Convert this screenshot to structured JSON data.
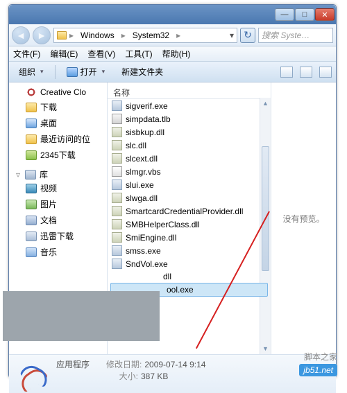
{
  "breadcrumb": {
    "p1": "Windows",
    "p2": "System32"
  },
  "search": {
    "placeholder": "搜索 Syste…"
  },
  "menus": {
    "file": "文件(F)",
    "edit": "编辑(E)",
    "view": "查看(V)",
    "tools": "工具(T)",
    "help": "帮助(H)"
  },
  "toolbar": {
    "org": "组织",
    "open": "打开",
    "newfolder": "新建文件夹"
  },
  "side": {
    "cc": "Creative Clo",
    "downloads": "下载",
    "desktop": "桌面",
    "recent": "最近访问的位",
    "dl2345": "2345下载",
    "lib": "库",
    "video": "视频",
    "pic": "图片",
    "doc": "文档",
    "xunlei": "迅雷下载",
    "music": "音乐"
  },
  "col": {
    "name": "名称"
  },
  "files": [
    {
      "n": "sigverif.exe",
      "t": "exe"
    },
    {
      "n": "simpdata.tlb",
      "t": "tlb"
    },
    {
      "n": "sisbkup.dll",
      "t": "dll"
    },
    {
      "n": "slc.dll",
      "t": "dll"
    },
    {
      "n": "slcext.dll",
      "t": "dll"
    },
    {
      "n": "slmgr.vbs",
      "t": "vbs"
    },
    {
      "n": "slui.exe",
      "t": "exe"
    },
    {
      "n": "slwga.dll",
      "t": "dll"
    },
    {
      "n": "SmartcardCredentialProvider.dll",
      "t": "dll"
    },
    {
      "n": "SMBHelperClass.dll",
      "t": "dll"
    },
    {
      "n": "SmiEngine.dll",
      "t": "dll"
    },
    {
      "n": "smss.exe",
      "t": "exe"
    },
    {
      "n": "SndVol.exe",
      "t": "exe"
    }
  ],
  "frag1": "dll",
  "frag2": "ool.exe",
  "preview": {
    "none": "没有预览。"
  },
  "status": {
    "type": "应用程序",
    "date_lbl": "修改日期:",
    "date": "2009-07-14 9:14",
    "size_lbl": "大小:",
    "size": "387 KB"
  },
  "watermark": "jb51.net",
  "watermark_cn": "脚本之家"
}
